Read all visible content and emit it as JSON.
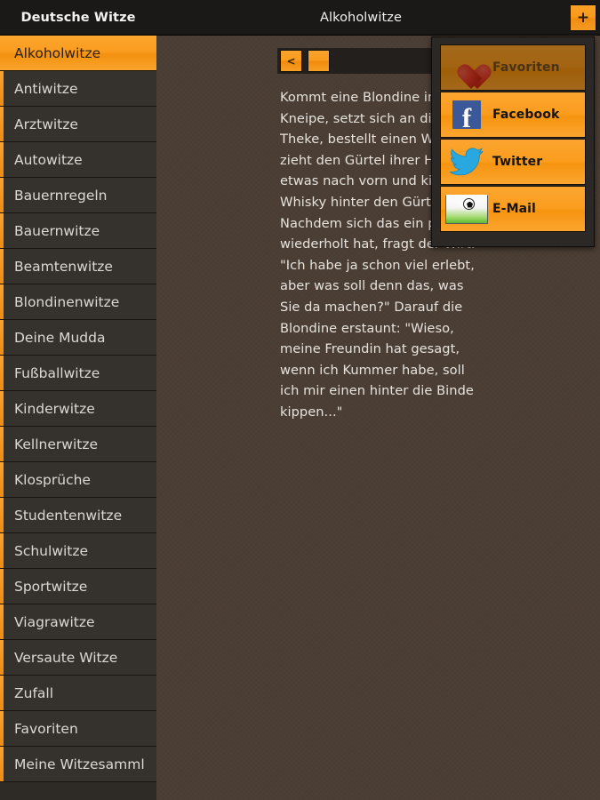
{
  "header": {
    "app_title": "Deutsche Witze",
    "page_title": "Alkoholwitze",
    "add_button_label": "+"
  },
  "nav": {
    "prev_label": "<",
    "next_label": ""
  },
  "joke": {
    "text": "Kommt eine Blondine in die Kneipe, setzt sich an die Theke, bestellt einen Whisky, zieht den Gürtel ihrer Hose etwas nach vorn und kippt den Whisky hinter den Gürtel. Nachdem sich das ein paar mal wiederholt hat, fragt der Wirt: \"Ich habe ja schon viel erlebt, aber was soll denn das, was Sie da machen?\" Darauf die Blondine erstaunt: \"Wieso, meine Freundin hat gesagt, wenn ich Kummer habe, soll ich mir einen hinter die Binde kippen...\""
  },
  "sidebar": {
    "items": [
      {
        "label": "Alkoholwitze",
        "selected": true
      },
      {
        "label": "Antiwitze",
        "selected": false
      },
      {
        "label": "Arztwitze",
        "selected": false
      },
      {
        "label": "Autowitze",
        "selected": false
      },
      {
        "label": "Bauernregeln",
        "selected": false
      },
      {
        "label": "Bauernwitze",
        "selected": false
      },
      {
        "label": "Beamtenwitze",
        "selected": false
      },
      {
        "label": "Blondinenwitze",
        "selected": false
      },
      {
        "label": "Deine Mudda",
        "selected": false
      },
      {
        "label": "Fußballwitze",
        "selected": false
      },
      {
        "label": "Kinderwitze",
        "selected": false
      },
      {
        "label": "Kellnerwitze",
        "selected": false
      },
      {
        "label": "Klosprüche",
        "selected": false
      },
      {
        "label": "Studentenwitze",
        "selected": false
      },
      {
        "label": "Schulwitze",
        "selected": false
      },
      {
        "label": "Sportwitze",
        "selected": false
      },
      {
        "label": "Viagrawitze",
        "selected": false
      },
      {
        "label": "Versaute Witze",
        "selected": false
      },
      {
        "label": "Zufall",
        "selected": false
      },
      {
        "label": "Favoriten",
        "selected": false
      },
      {
        "label": "Meine Witzesamml",
        "selected": false
      }
    ]
  },
  "share_popup": {
    "items": [
      {
        "label": "Favoriten",
        "icon": "heart-icon",
        "dimmed": true
      },
      {
        "label": "Facebook",
        "icon": "facebook-icon",
        "dimmed": false
      },
      {
        "label": "Twitter",
        "icon": "twitter-icon",
        "dimmed": false
      },
      {
        "label": "E-Mail",
        "icon": "envelope-icon",
        "dimmed": false
      }
    ]
  },
  "colors": {
    "accent_orange": "#fb9d1f",
    "header_dark": "#1b1917",
    "content_brown": "#4b3e34",
    "sidebar_row": "#35312c",
    "popup_bg": "#2b2825",
    "twitter_blue": "#29a8e0",
    "facebook_blue": "#3b5998"
  }
}
